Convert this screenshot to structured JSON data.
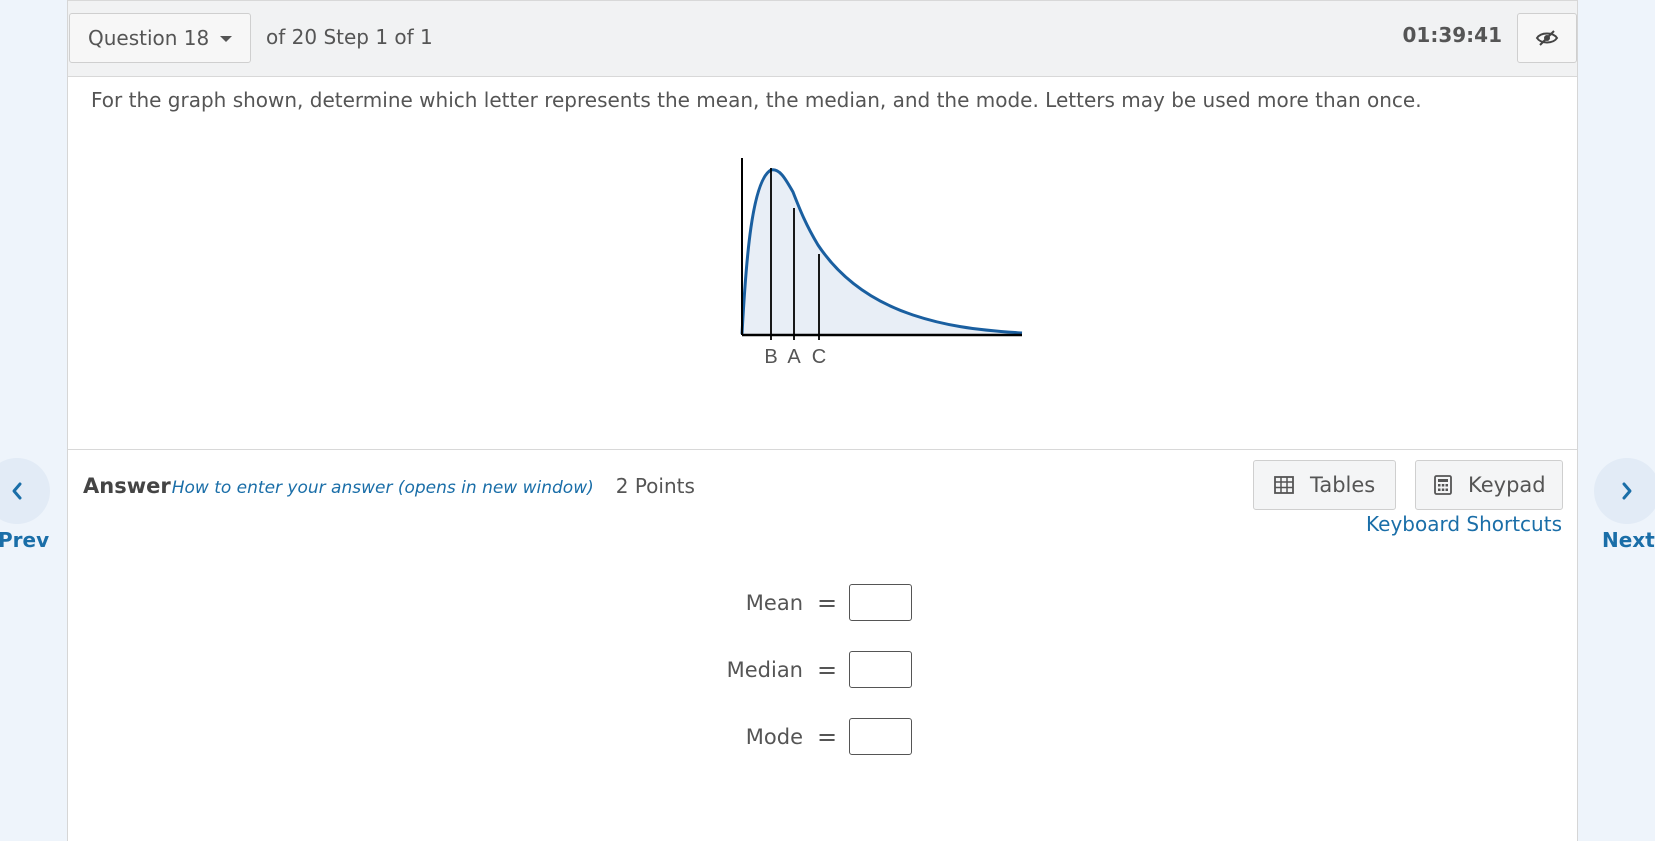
{
  "header": {
    "question_selector": "Question 18",
    "progress": "of 20 Step 1 of 1",
    "timer": "01:39:41"
  },
  "question": {
    "text": "For the graph shown, determine which letter represents the mean, the median, and the mode. Letters may be used more than once.",
    "graph_labels": [
      "B",
      "A",
      "C"
    ]
  },
  "answer": {
    "label": "Answer",
    "howto": "How to enter your answer (opens in new window)",
    "points": "2 Points",
    "tables_label": "Tables",
    "keypad_label": "Keypad",
    "shortcuts": "Keyboard Shortcuts",
    "fields": [
      {
        "label": "Mean",
        "sign": "=",
        "value": ""
      },
      {
        "label": "Median",
        "sign": "=",
        "value": ""
      },
      {
        "label": "Mode",
        "sign": "=",
        "value": ""
      }
    ]
  },
  "nav": {
    "prev": "Prev",
    "next": "Next"
  },
  "colors": {
    "curve": "#1a5fa0",
    "link": "#1a6ea8",
    "page_bg": "#eef4fb"
  }
}
